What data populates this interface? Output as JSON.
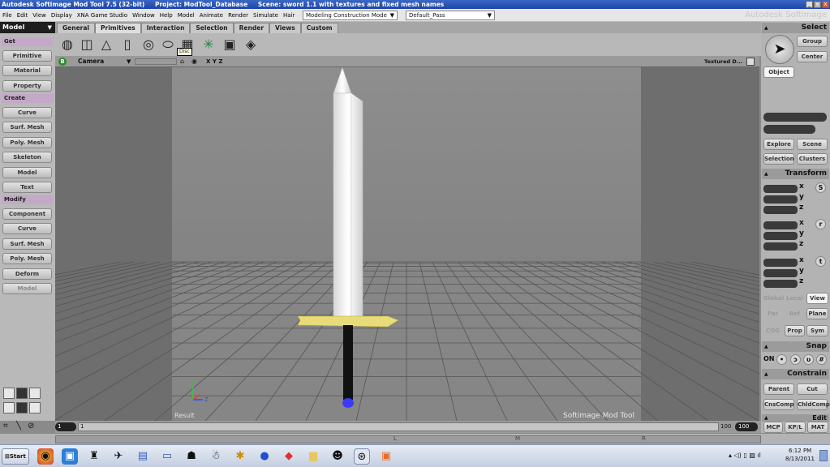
{
  "window": {
    "title_app": "Autodesk Softimage Mod Tool 7.5 (32-bit)",
    "title_project": "Project: ModTool_Database",
    "title_scene": "Scene: sword 1.1 with textures and fixed mesh names",
    "brand": "Autodesk Softimage",
    "controls": [
      "_",
      "□",
      "x"
    ]
  },
  "menubar": {
    "items": [
      "File",
      "Edit",
      "View",
      "Display",
      "XNA Game Studio",
      "Window",
      "Help",
      "Model",
      "Animate",
      "Render",
      "Simulate",
      "Hair"
    ],
    "mode_dropdown": "Modeling Construction Mode",
    "pass_dropdown": "Default_Pass"
  },
  "model_selector": "Model",
  "tabs": [
    "General",
    "Primitives",
    "Interaction",
    "Selection",
    "Render",
    "Views",
    "Custom"
  ],
  "active_tab": "Primitives",
  "primitive_tooltip": "Disc",
  "left_panel": {
    "get_header": "Get",
    "get_items": [
      "Primitive",
      "Material",
      "Property"
    ],
    "create_header": "Create",
    "create_items": [
      "Curve",
      "Surf. Mesh",
      "Poly. Mesh",
      "Skeleton",
      "Model",
      "Text"
    ],
    "modify_header": "Modify",
    "modify_items": [
      "Component",
      "Curve",
      "Surf. Mesh",
      "Poly. Mesh",
      "Deform",
      "Model"
    ]
  },
  "viewport": {
    "badge": "B",
    "camera": "Camera",
    "axes_label": "X Y Z",
    "display_mode": "Textured D...",
    "result_label": "Result",
    "watermark": "Softimage Mod Tool",
    "axis_y": "Y",
    "axis_z": "Z"
  },
  "right_panel": {
    "select_header": "Select",
    "group_btn": "Group",
    "center_btn": "Center",
    "object_btn": "Object",
    "explore_btn": "Explore",
    "scene_btn": "Scene",
    "selection_btn": "Selection",
    "clusters_btn": "Clusters",
    "transform_header": "Transform",
    "axes": [
      "x",
      "y",
      "z"
    ],
    "scale_btn": "S",
    "rotate_btn": "r",
    "translate_btn": "t",
    "global_btn": "Global",
    "local_btn": "Local",
    "view_btn": "View",
    "par_btn": "Par",
    "ref_btn": "Ref",
    "plane_btn": "Plane",
    "cog_btn": "COG",
    "prop_btn": "Prop",
    "sym_btn": "Sym",
    "snap_header": "Snap",
    "snap_on": "ON",
    "constrain_header": "Constrain",
    "parent_btn": "Parent",
    "cut_btn": "Cut",
    "cnscomp_btn": "CnsComp",
    "chldcomp_btn": "ChldComp",
    "edit_header": "Edit"
  },
  "timeline": {
    "start_frame": "1",
    "current_frame": "1",
    "end_frame": "100",
    "end_frame_box": "100"
  },
  "statusbar": {
    "markers": [
      "L",
      "M",
      "R"
    ],
    "mcp": "MCP",
    "kpl": "KP/L",
    "mat": "MAT"
  },
  "taskbar": {
    "start_label": "Start",
    "time": "6:12 PM",
    "date": "8/13/2011"
  },
  "colors": {
    "title_blue": "#2a55b8",
    "panel_header_purple": "#c4a8c8",
    "sword_guard": "#e8dc7a",
    "sword_blade": "#f2f2f2",
    "pommel": "#3a3aff"
  }
}
